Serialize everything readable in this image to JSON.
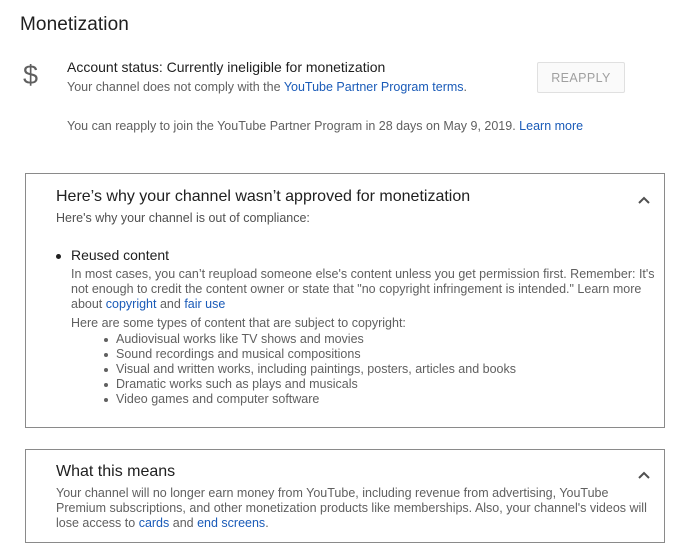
{
  "page": {
    "title": "Monetization"
  },
  "status": {
    "icon": "dollar-icon",
    "icon_glyph": "$",
    "account_status": "Account status: Currently ineligible for monetization",
    "comply_prefix": "Your channel does not comply with the ",
    "comply_link": "YouTube Partner Program terms",
    "comply_suffix": ".",
    "reapply_button": "REAPPLY",
    "reapply_note": "You can reapply to join the YouTube Partner Program in 28 days on May 9, 2019.",
    "learn_more": "Learn more"
  },
  "panel_reason": {
    "title": "Here’s why your channel wasn’t approved for monetization",
    "subtitle": "Here's why your channel is out of compliance:",
    "item_label": "Reused content",
    "para_text": "In most cases, you can’t reupload someone else's content unless you get permission first. Remember: It's not enough to credit the content owner or state that \"no copyright infringement is intended.\" Learn more about ",
    "link_copyright": "copyright",
    "and_text": " and ",
    "link_fair_use": "fair use",
    "types_intro": "Here are some types of content that are subject to copyright:",
    "types": [
      "Audiovisual works like TV shows and movies",
      "Sound recordings and musical compositions",
      "Visual and written works, including paintings, posters, articles and books",
      "Dramatic works such as plays and musicals",
      "Video games and computer software"
    ]
  },
  "panel_meaning": {
    "title": "What this means",
    "text": "Your channel will no longer earn money from YouTube, including revenue from advertising, YouTube Premium subscriptions, and other monetization products like memberships. Also, your channel's videos will lose access to ",
    "link_cards": "cards",
    "and_text": " and ",
    "link_end_screens": "end screens",
    "suffix": "."
  },
  "colors": {
    "link": "#1a5bb8",
    "border": "#8a8a8a",
    "muted_text": "#606060"
  }
}
